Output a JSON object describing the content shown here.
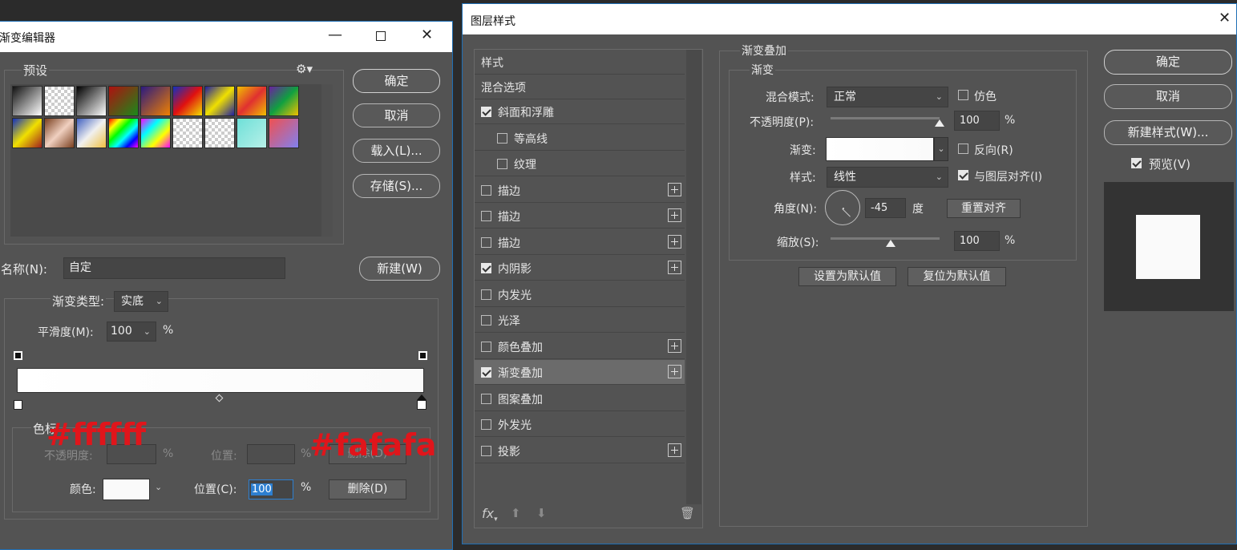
{
  "gradient_editor": {
    "title": "渐变编辑器",
    "presets_label": "预设",
    "buttons": {
      "ok": "确定",
      "cancel": "取消",
      "load": "载入(L)...",
      "save": "存储(S)...",
      "new": "新建(W)"
    },
    "name_label": "名称(N):",
    "name_value": "自定",
    "type_label": "渐变类型:",
    "type_value": "实底",
    "smoothness_label": "平滑度(M):",
    "smoothness_value": "100",
    "percent": "%",
    "stops_group_label": "色标",
    "opacity_label": "不透明度:",
    "location_label_dim": "位置:",
    "delete_dim": "删除(D)",
    "color_label": "颜色:",
    "location_label": "位置(C):",
    "location_value": "100",
    "delete_button": "删除(D)",
    "preset_swatches": [
      "linear-gradient(135deg,#111,#fff)",
      "checker",
      "linear-gradient(135deg,#000,#fff)",
      "linear-gradient(135deg,#b01010,#1a8a1a)",
      "linear-gradient(135deg,#2a1a80,#f08000)",
      "linear-gradient(135deg,#1030c0,#e01010,#f0e000)",
      "linear-gradient(135deg,#2020a0,#f0e000,#2020a0)",
      "linear-gradient(135deg,#f0c000,#e03030,#f0c000)",
      "linear-gradient(135deg,#6a20a0,#10a040,#f0c000)",
      "linear-gradient(135deg,#1030c0,#f0e000,#a02020)",
      "linear-gradient(135deg,#7a4020,#f0d0c0,#7a4020)",
      "linear-gradient(135deg,#4060c0,#f0f0f0,#f0c040)",
      "linear-gradient(135deg,#ff0000,#ff0,#0f0,#0ff,#00f,#f0f)",
      "linear-gradient(135deg,#ff00ff,#00ffff,#ffff00,#ff00ff)",
      "checker",
      "checker",
      "linear-gradient(135deg,#6ee0d8,#b8f0e8)",
      "linear-gradient(135deg,#f05050,#8080f0)"
    ],
    "colors": {
      "gradient_start": "#ffffff",
      "gradient_end": "#fafafa"
    }
  },
  "annotations": {
    "left": "#ffffff",
    "right": "#fafafa"
  },
  "layer_style": {
    "title": "图层样式",
    "styles_header": "样式",
    "blend_options": "混合选项",
    "items": [
      {
        "label": "斜面和浮雕",
        "checked": true,
        "plus": false
      },
      {
        "label": "等高线",
        "checked": false,
        "plus": false
      },
      {
        "label": "纹理",
        "checked": false,
        "plus": false
      },
      {
        "label": "描边",
        "checked": false,
        "plus": true
      },
      {
        "label": "描边",
        "checked": false,
        "plus": true
      },
      {
        "label": "描边",
        "checked": false,
        "plus": true
      },
      {
        "label": "内阴影",
        "checked": true,
        "plus": true
      },
      {
        "label": "内发光",
        "checked": false,
        "plus": false
      },
      {
        "label": "光泽",
        "checked": false,
        "plus": false
      },
      {
        "label": "颜色叠加",
        "checked": false,
        "plus": true
      },
      {
        "label": "渐变叠加",
        "checked": true,
        "plus": true
      },
      {
        "label": "图案叠加",
        "checked": false,
        "plus": false
      },
      {
        "label": "外发光",
        "checked": false,
        "plus": false
      },
      {
        "label": "投影",
        "checked": false,
        "plus": true
      }
    ],
    "fx_label": "fx",
    "section_title": "渐变叠加",
    "subsection_title": "渐变",
    "blend_mode_label": "混合模式:",
    "blend_mode_value": "正常",
    "dither_label": "仿色",
    "opacity_label": "不透明度(P):",
    "opacity_value": "100",
    "opacity_level": 1.0,
    "percent": "%",
    "gradient_label": "渐变:",
    "reverse_label": "反向(R)",
    "style_label": "样式:",
    "style_value": "线性",
    "align_label": "与图层对齐(I)",
    "angle_label": "角度(N):",
    "angle_value": "-45",
    "degree": "度",
    "reset_align": "重置对齐",
    "scale_label": "缩放(S):",
    "scale_value": "100",
    "scale_level": 0.55,
    "set_default": "设置为默认值",
    "reset_default": "复位为默认值",
    "buttons": {
      "ok": "确定",
      "cancel": "取消",
      "new_style": "新建样式(W)..."
    },
    "preview_label": "预览(V)"
  }
}
